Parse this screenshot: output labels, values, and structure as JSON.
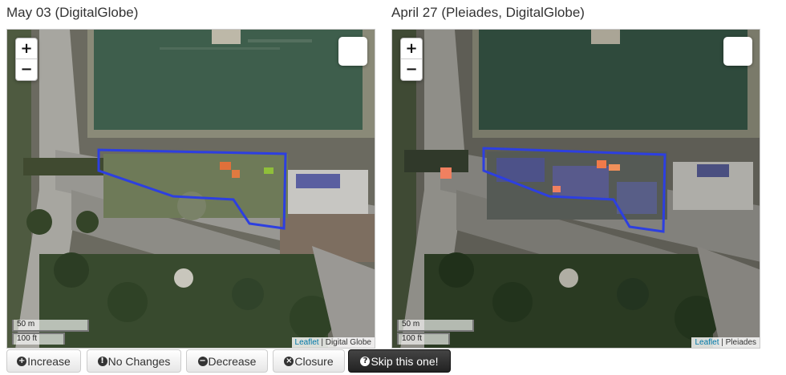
{
  "panels": {
    "left": {
      "title": "May 03 (DigitalGlobe)",
      "attribution_link": "Leaflet",
      "attribution_source": "Digital Globe"
    },
    "right": {
      "title": "April 27 (Pleiades, DigitalGlobe)",
      "attribution_link": "Leaflet",
      "attribution_source": "Pleiades"
    }
  },
  "map_controls": {
    "zoom_in": "+",
    "zoom_out": "−",
    "scale_metric": "50 m",
    "scale_imperial": "100 ft"
  },
  "attribution_separator": " | ",
  "buttons": {
    "increase": {
      "icon": "plus-circle-icon",
      "glyph": "+",
      "label": "Increase"
    },
    "no_changes": {
      "icon": "exclamation-circle-icon",
      "glyph": "!",
      "label": "No Changes"
    },
    "decrease": {
      "icon": "minus-circle-icon",
      "glyph": "−",
      "label": "Decrease"
    },
    "closure": {
      "icon": "x-circle-icon",
      "glyph": "×",
      "label": "Closure"
    },
    "skip": {
      "icon": "question-circle-icon",
      "glyph": "?",
      "label": "Skip this one!"
    }
  },
  "colors": {
    "aoi_outline": "#2d3fe0",
    "water": "#3e5e4c",
    "vegetation": "#3f5a33",
    "road": "#9a9a96",
    "skip_button": "#222222"
  }
}
